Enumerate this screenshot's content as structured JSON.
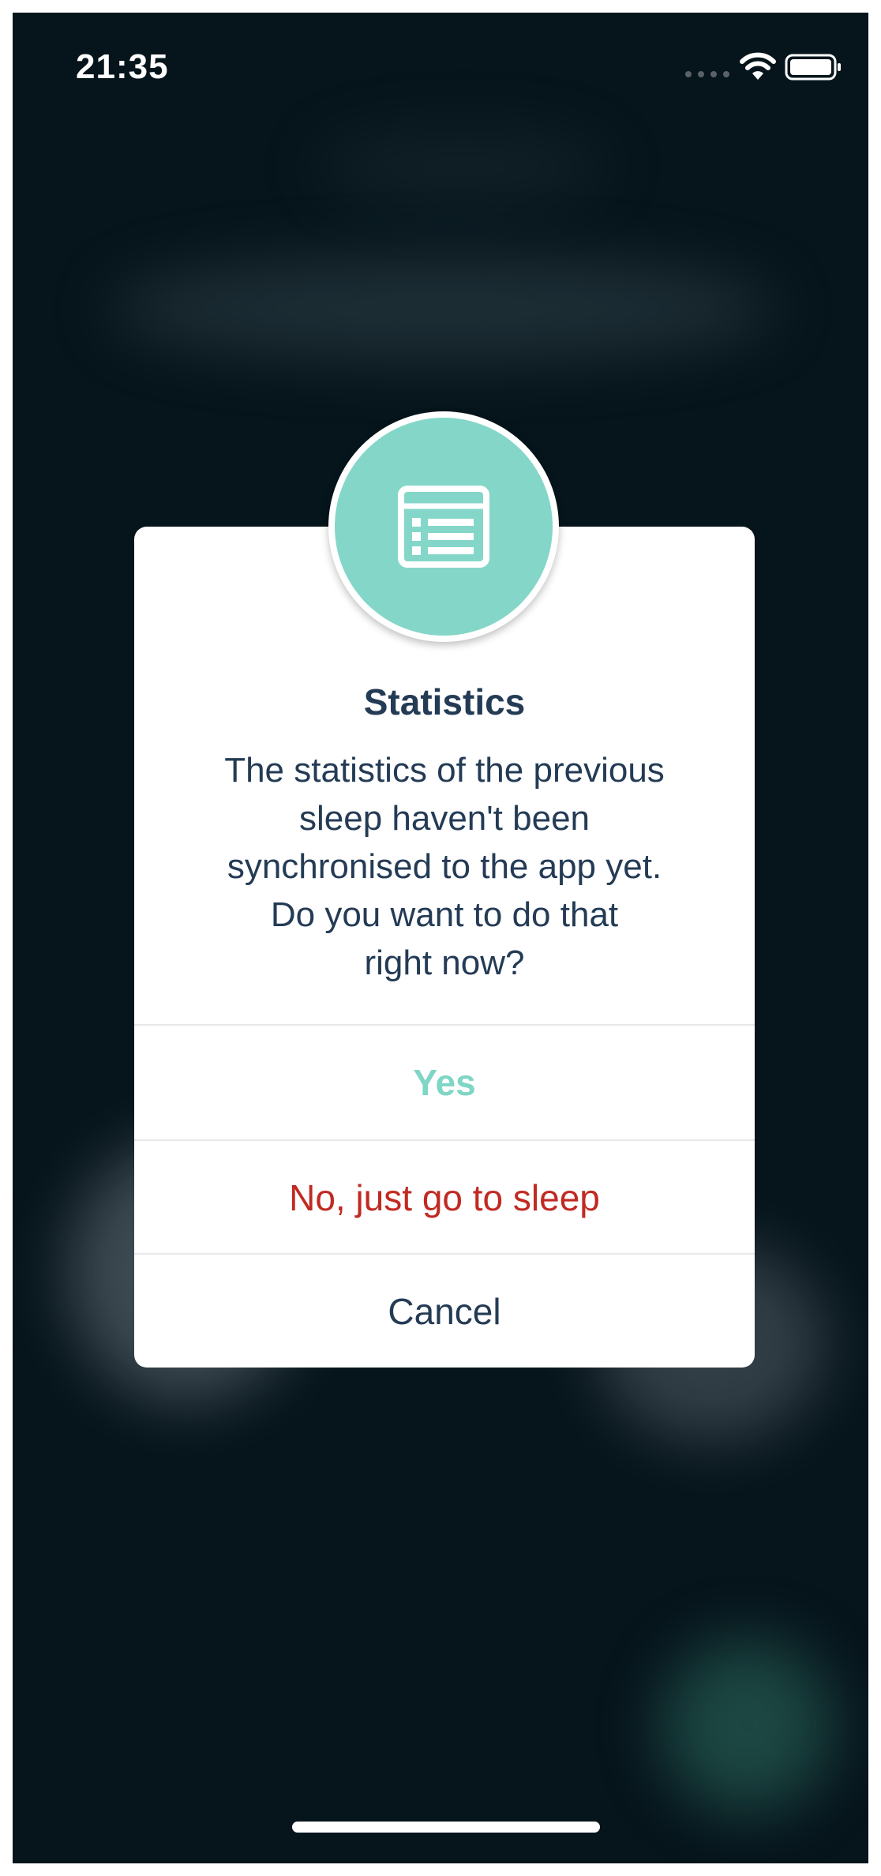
{
  "status_bar": {
    "time": "21:35",
    "signal_icon": "signal-dots-icon",
    "wifi_icon": "wifi-icon",
    "battery_icon": "battery-icon"
  },
  "dialog": {
    "icon": "statistics-list-icon",
    "title": "Statistics",
    "message_lines": [
      "The statistics of the previous",
      "sleep haven't been",
      "synchronised to the app yet.",
      "Do you want to do that",
      "right now?"
    ],
    "buttons": {
      "yes": "Yes",
      "no": "No, just go to sleep",
      "cancel": "Cancel"
    }
  },
  "colors": {
    "background": "#06141b",
    "accent_teal": "#84d7c8",
    "yes_text": "#7fd6c5",
    "no_text": "#c02a22",
    "dark_text": "#243b55"
  }
}
